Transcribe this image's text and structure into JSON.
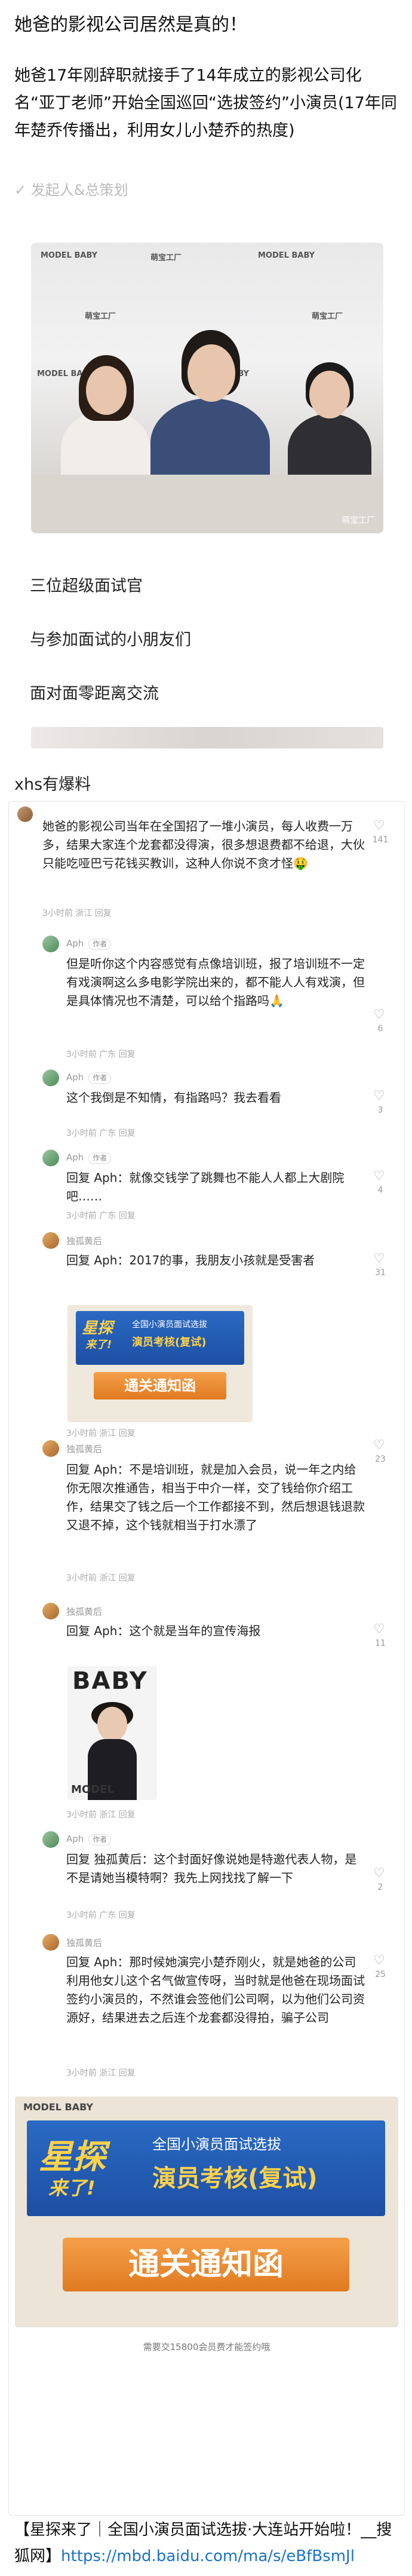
{
  "post": {
    "title": "她爸的影视公司居然是真的！",
    "body": "她爸17年刚辞职就接手了14年成立的影视公司化名“亚丁老师”开始全国巡回“选拔签约”小演员(17年同年楚乔传播出，利用女儿小楚乔的热度)",
    "faded_line": "✓ 发起人&总策划"
  },
  "photo1": {
    "watermark": "萌宝工厂",
    "logo_a": "MODEL BABY",
    "logo_b": "萌宝工厂"
  },
  "captions": {
    "c1": "三位超级面试官",
    "c2": "与参加面试的小朋友们",
    "c3": "面对面零距离交流"
  },
  "section_label": "xhs有爆料",
  "comments": [
    {
      "text": "她爸的影视公司当年在全国招了一堆小演员，每人收费一万多，结果大家连个龙套都没得演，很多想退费都不给退，大伙只能吃哑巴亏花钱买教训，这种人你说不贪才怪🤑",
      "meta": "3小时前  浙江  回复",
      "likes": "141"
    },
    {
      "name": "Aph",
      "tag": "作者",
      "text": "但是听你这个内容感觉有点像培训班，报了培训班不一定有戏演啊这么多电影学院出来的，都不能人人有戏演，但是具体情况也不清楚，可以给个指路吗🙏",
      "meta": "3小时前  广东  回复",
      "likes": "6"
    },
    {
      "name": "Aph",
      "tag": "作者",
      "text": "这个我倒是不知情，有指路吗？我去看看",
      "meta": "3小时前  广东  回复",
      "likes": "3"
    },
    {
      "name": "Aph",
      "tag": "作者",
      "text": "回复 Aph：就像交钱学了跳舞也不能人人都上大剧院吧……",
      "meta": "3小时前  广东  回复",
      "likes": "4"
    },
    {
      "name": "独孤黄后",
      "text": "回复 Aph：2017的事，我朋友小孩就是受害者",
      "meta": "3小时前  浙江  回复",
      "likes": "31"
    },
    {
      "name": "独孤黄后",
      "text": "回复 Aph：不是培训班，就是加入会员，说一年之内给你无限次推通告，相当于中介一样，交了钱给你介绍工作，结果交了钱之后一个工作都接不到，然后想退钱退款又退不掉，这个钱就相当于打水漂了",
      "meta": "3小时前  浙江  回复",
      "likes": "23"
    },
    {
      "name": "独孤黄后",
      "text": "回复 Aph：这个就是当年的宣传海报",
      "meta": "3小时前  浙江  回复",
      "likes": "11"
    },
    {
      "name": "Aph",
      "tag": "作者",
      "text": "回复 独孤黄后：这个封面好像说她是特邀代表人物，是不是请她当模特啊？我先上网找找了解一下",
      "meta": "3小时前  广东  回复",
      "likes": "2"
    },
    {
      "name": "独孤黄后",
      "text": "回复 Aph：那时候她演完小楚乔刚火，就是她爸的公司利用他女儿这个名气做宣传呀，当时就是他爸在现场面试签约小演员的，不然谁会签他们公司啊，以为他们公司资源好，结果进去之后连个龙套都没得拍，骗子公司",
      "meta": "3小时前  浙江  回复",
      "likes": "25"
    }
  ],
  "notice1": {
    "star": "星探",
    "come": "来了!",
    "line1": "全国小演员面试选拔",
    "line2": "演员考核(复试)",
    "banner": "通关通知函"
  },
  "poster": {
    "title": "BABY",
    "model": "MODEL"
  },
  "notice2": {
    "brand": "MODEL BABY",
    "star": "星探",
    "come": "来了!",
    "line1": "全国小演员面试选拔",
    "line2": "演员考核(复试)",
    "banner": "通关通知函",
    "caption": "需要交15800会员费才能签约哦"
  },
  "footer": {
    "text": "【星探来了｜全国小演员面试选拔·大连站开始啦！__搜狐网】",
    "link": "https://mbd.baidu.com/ma/s/eBfBsmJl"
  }
}
